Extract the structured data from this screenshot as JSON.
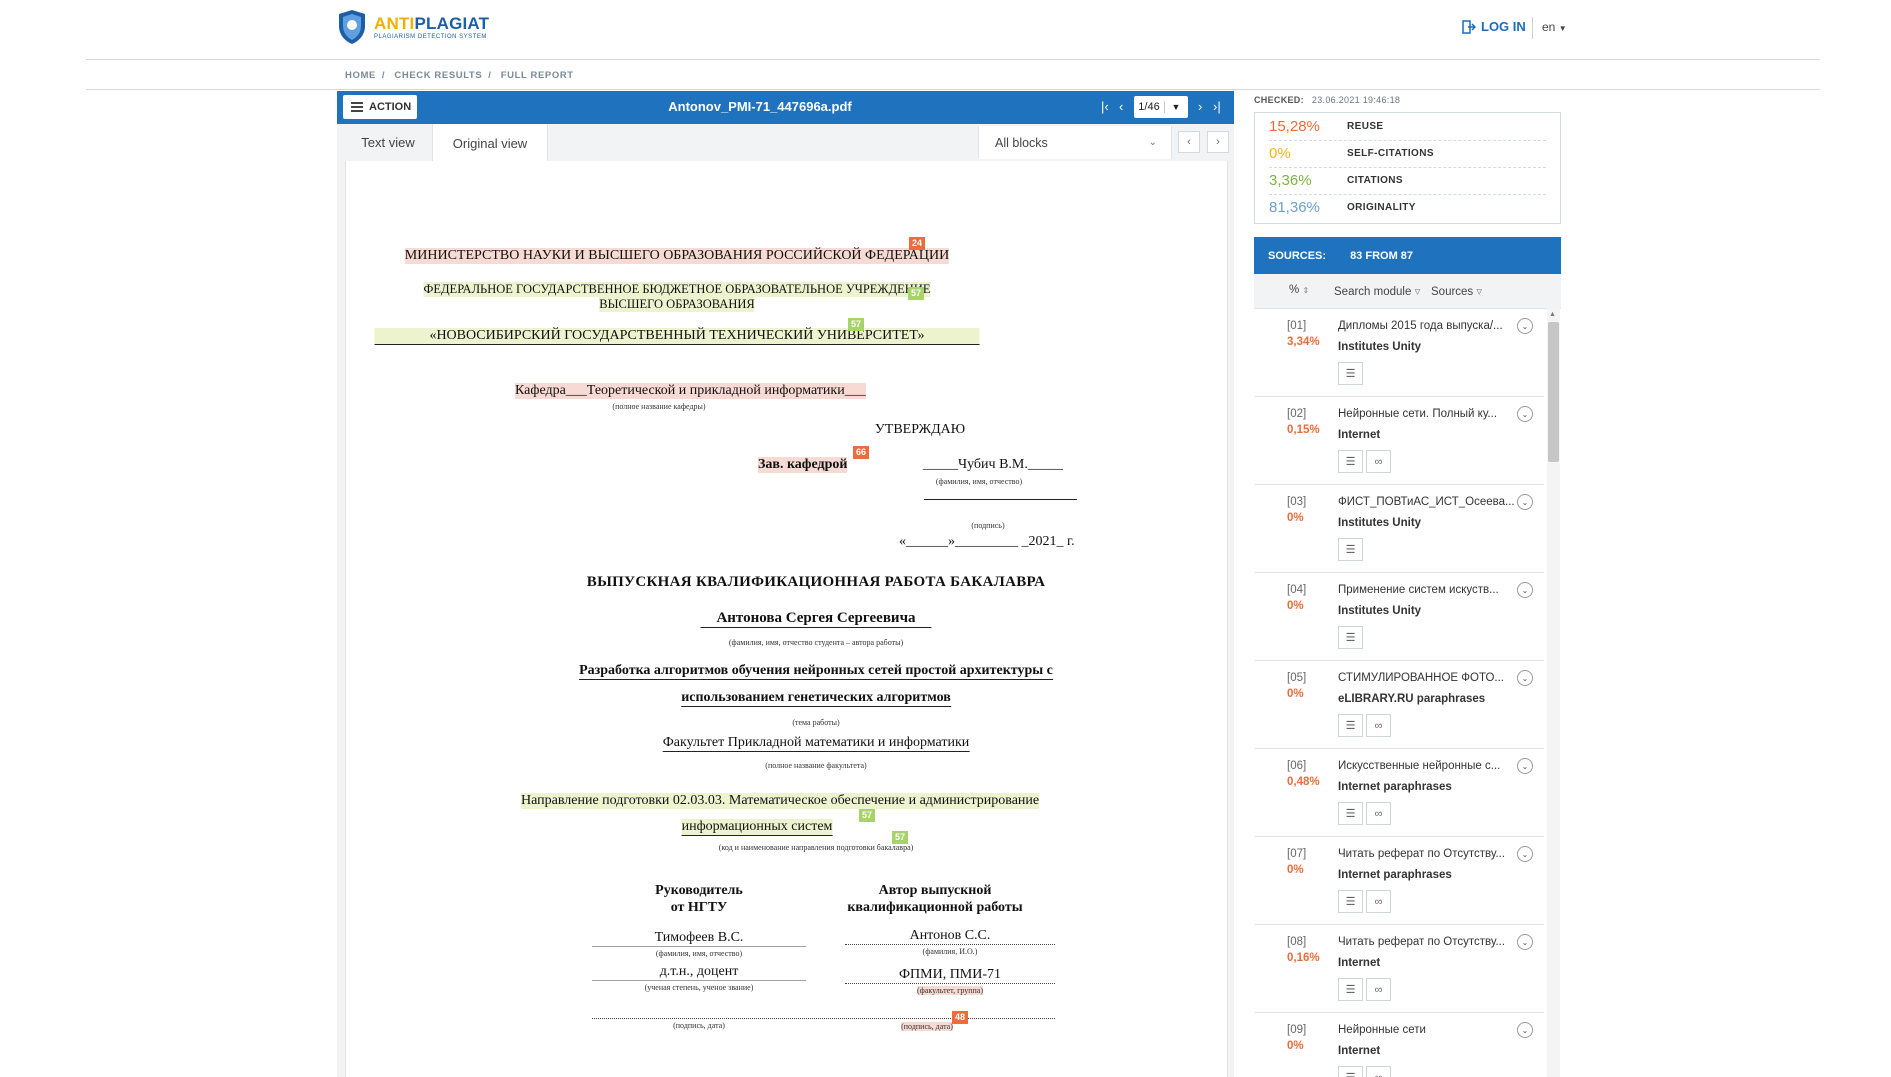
{
  "header": {
    "logo_main_a": "ANTI",
    "logo_main_b": "PLAGIAT",
    "logo_sub": "PLAGIARISM DETECTION SYSTEM",
    "login_label": "LOG IN",
    "language": "en"
  },
  "breadcrumb": [
    "HOME",
    "CHECK RESULTS",
    "FULL REPORT"
  ],
  "viewer": {
    "action_label": "ACTION",
    "filename": "Antonov_PMI-71_447696a.pdf",
    "page_value": "1/46",
    "tabs": [
      "Text view",
      "Original view"
    ],
    "blocks_select": "All blocks"
  },
  "document": {
    "ministry": "МИНИСТЕРСТВО НАУКИ И ВЫСШЕГО ОБРАЗОВАНИЯ РОССИЙСКОЙ ФЕДЕРАЦИИ",
    "institution_1": "ФЕДЕРАЛЬНОЕ ГОСУДАРСТВЕННОЕ БЮДЖЕТНОЕ ОБРАЗОВАТЕЛЬНОЕ УЧРЕЖДЕНИЕ",
    "institution_2": "ВЫСШЕГО ОБРАЗОВАНИЯ",
    "university": "«НОВОСИБИРСКИЙ ГОСУДАРСТВЕННЫЙ ТЕХНИЧЕСКИЙ УНИВЕРСИТЕТ»",
    "department": "Кафедра___Теоретической и прикладной информатики___",
    "department_hint": "(полное название кафедры)",
    "approve": "УТВЕРЖДАЮ",
    "head_label": "Зав. кафедрой",
    "head_name": "_____Чубич В.М._____",
    "name_hint": "(фамилия, имя, отчество)",
    "signature_hint": "(подпись)",
    "date_line": "«______»_________ _2021_ г.",
    "work_title": "ВЫПУСКНАЯ КВАЛИФИКАЦИОННАЯ РАБОТА БАКАЛАВРА",
    "student": "Антонова Сергея Сергеевича",
    "student_hint": "(фамилия, имя, отчество студента – автора работы)",
    "topic_1": "Разработка алгоритмов обучения нейронных сетей простой архитектуры с",
    "topic_2": "использованием генетических алгоритмов",
    "topic_hint": "(тема работы)",
    "faculty": "Факультет Прикладной математики и информатики",
    "faculty_hint": "(полное название факультета)",
    "direction_1": "Направление подготовки   02.03.03. Математическое обеспечение и администрирование",
    "direction_2": "информационных систем",
    "direction_hint": "(код и наименование направления подготовки бакалавра)",
    "supervisor_title_1": "Руководитель",
    "supervisor_title_2": "от НГТУ",
    "author_title_1": "Автор выпускной",
    "author_title_2": "квалификационной работы",
    "supervisor_name": "Тимофеев В.С.",
    "supervisor_name_hint": "(фамилия, имя, отчество)",
    "supervisor_degree": "д.т.н., доцент",
    "supervisor_degree_hint": "(ученая степень, ученое звание)",
    "supervisor_sign_hint": "(подпись, дата)",
    "author_name": "Антонов С.С.",
    "author_name_hint": "(фамилия, И.О.)",
    "author_group": "ФПМИ, ПМИ-71",
    "author_group_hint": "(факультет, группа)",
    "author_sign_hint": "(подпись, дата)",
    "badges": [
      "24",
      "57",
      "57",
      "66",
      "57",
      "57",
      "48"
    ]
  },
  "report": {
    "checked_label": "CHECKED:",
    "checked_value": "23.06.2021 19:46:18",
    "stats": [
      {
        "value": "15,28%",
        "label": "REUSE",
        "color": "#ef6c3a"
      },
      {
        "value": "0%",
        "label": "SELF-CITATIONS",
        "color": "#f2b21b"
      },
      {
        "value": "3,36%",
        "label": "CITATIONS",
        "color": "#7cb342"
      },
      {
        "value": "81,36%",
        "label": "ORIGINALITY",
        "color": "#6aa0d8"
      }
    ],
    "sources_label": "SOURCES:",
    "sources_count": "83 FROM 87",
    "columns": [
      "%",
      "Search module",
      "Sources"
    ],
    "sources": [
      {
        "num": "[01]",
        "pct": "3,34%",
        "title": "Дипломы 2015 года выпуска/...",
        "module": "Institutes Unity",
        "link": false
      },
      {
        "num": "[02]",
        "pct": "0,15%",
        "title": "Нейронные сети. Полный ку...",
        "module": "Internet",
        "link": true
      },
      {
        "num": "[03]",
        "pct": "0%",
        "title": "ФИСТ_ПОВТиАС_ИСТ_Осеева...",
        "module": "Institutes Unity",
        "link": false
      },
      {
        "num": "[04]",
        "pct": "0%",
        "title": "Применение систем искуств...",
        "module": "Institutes Unity",
        "link": false
      },
      {
        "num": "[05]",
        "pct": "0%",
        "title": "СТИМУЛИРОВАННОЕ ФОТО...",
        "module": "eLIBRARY.RU paraphrases",
        "link": true
      },
      {
        "num": "[06]",
        "pct": "0,48%",
        "title": "Искусственные нейронные с...",
        "module": "Internet paraphrases",
        "link": true
      },
      {
        "num": "[07]",
        "pct": "0%",
        "title": "Читать реферат по Отсутству...",
        "module": "Internet paraphrases",
        "link": true
      },
      {
        "num": "[08]",
        "pct": "0,16%",
        "title": "Читать реферат по Отсутству...",
        "module": "Internet",
        "link": true
      },
      {
        "num": "[09]",
        "pct": "0%",
        "title": "Нейронные сети",
        "module": "Internet",
        "link": true
      }
    ]
  }
}
